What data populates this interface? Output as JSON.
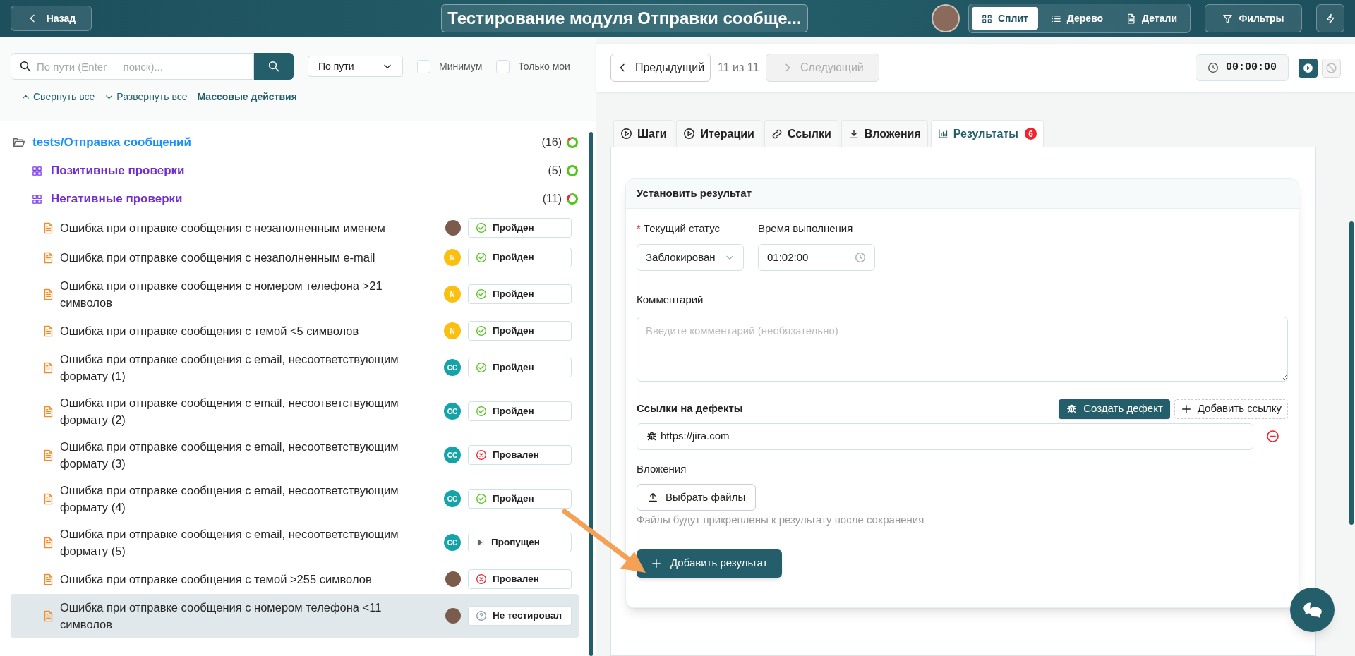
{
  "header": {
    "back": "Назад",
    "title": "Тестирование модуля Отправки сообще...",
    "views": [
      {
        "label": "Сплит",
        "kind": "split",
        "selected": true
      },
      {
        "label": "Дерево",
        "kind": "tree",
        "selected": false
      },
      {
        "label": "Детали",
        "kind": "details",
        "selected": false
      }
    ],
    "filters": "Фильтры"
  },
  "sidebar": {
    "search": {
      "placeholder": "По пути (Enter — поиск)..."
    },
    "sort": "По пути",
    "checkboxes": [
      {
        "label": "Минимум",
        "checked": false
      },
      {
        "label": "Только мои",
        "checked": false
      }
    ],
    "actions": [
      {
        "label": "Свернуть все",
        "kind": "collapse"
      },
      {
        "label": "Развернуть все",
        "kind": "expand"
      },
      {
        "label": "Массовые действия",
        "kind": "bulk"
      }
    ],
    "tree": [
      {
        "label": "tests/Отправка сообщений",
        "kind": "folder",
        "count": "(16)",
        "level": 0.8,
        "children": [
          {
            "label": "Позитивные проверки",
            "kind": "suite",
            "count": "(5)",
            "level": 1
          },
          {
            "label": "Негативные проверки",
            "kind": "suite",
            "count": "(11)",
            "level": 0.7,
            "children": [
              {
                "label": "Ошибка при отправке сообщения с незаполненным именем",
                "kind": "case",
                "selected": false,
                "assignee": {
                  "kind": "photo"
                },
                "status": {
                  "kind": "passed",
                  "label": "Пройден"
                }
              },
              {
                "label": "Ошибка при отправке сообщения с незаполненным e-mail",
                "kind": "case",
                "selected": false,
                "assignee": {
                  "kind": "initials",
                  "text": "N",
                  "color": "#fbbf0f"
                },
                "status": {
                  "kind": "passed",
                  "label": "Пройден"
                }
              },
              {
                "label": "Ошибка при отправке сообщения с номером телефона >21 символов",
                "kind": "case",
                "selected": false,
                "assignee": {
                  "kind": "initials",
                  "text": "N",
                  "color": "#fbbf0f"
                },
                "status": {
                  "kind": "passed",
                  "label": "Пройден"
                }
              },
              {
                "label": "Ошибка при отправке сообщения с темой <5 символов",
                "kind": "case",
                "selected": false,
                "assignee": {
                  "kind": "initials",
                  "text": "N",
                  "color": "#fbbf0f"
                },
                "status": {
                  "kind": "passed",
                  "label": "Пройден"
                }
              },
              {
                "label": "Ошибка при отправке сообщения с email, несоответствующим формату (1)",
                "kind": "case",
                "selected": false,
                "assignee": {
                  "kind": "initials",
                  "text": "CC",
                  "color": "#13a3a8"
                },
                "status": {
                  "kind": "passed",
                  "label": "Пройден"
                }
              },
              {
                "label": "Ошибка при отправке сообщения с email, несоответствующим формату (2)",
                "kind": "case",
                "selected": false,
                "assignee": {
                  "kind": "initials",
                  "text": "CC",
                  "color": "#13a3a8"
                },
                "status": {
                  "kind": "passed",
                  "label": "Пройден"
                }
              },
              {
                "label": "Ошибка при отправке сообщения с email, несоответствующим формату (3)",
                "kind": "case",
                "selected": false,
                "assignee": {
                  "kind": "initials",
                  "text": "CC",
                  "color": "#13a3a8"
                },
                "status": {
                  "kind": "failed",
                  "label": "Провален"
                }
              },
              {
                "label": "Ошибка при отправке сообщения с email, несоответствующим формату (4)",
                "kind": "case",
                "selected": false,
                "assignee": {
                  "kind": "initials",
                  "text": "CC",
                  "color": "#13a3a8"
                },
                "status": {
                  "kind": "passed",
                  "label": "Пройден"
                }
              },
              {
                "label": "Ошибка при отправке сообщения с email, несоответствующим формату (5)",
                "kind": "case",
                "selected": false,
                "assignee": {
                  "kind": "initials",
                  "text": "CC",
                  "color": "#13a3a8"
                },
                "status": {
                  "kind": "skipped",
                  "label": "Пропущен"
                }
              },
              {
                "label": "Ошибка при отправке сообщения с темой >255 символов",
                "kind": "case",
                "selected": false,
                "assignee": {
                  "kind": "photo"
                },
                "status": {
                  "kind": "failed",
                  "label": "Провален"
                }
              },
              {
                "label": "Ошибка при отправке сообщения с номером телефона <11 символов",
                "kind": "case",
                "selected": true,
                "assignee": {
                  "kind": "photo"
                },
                "status": {
                  "kind": "untested",
                  "label": "Не тестировал"
                }
              }
            ]
          }
        ]
      }
    ]
  },
  "navigator": {
    "prev": "Предыдущий",
    "position": "11 из 11",
    "next": {
      "label": "Следующий",
      "disabled": true
    },
    "timer": "00:00:00",
    "play": {
      "disabled": false
    },
    "stop": {
      "disabled": true
    }
  },
  "tabs": [
    {
      "label": "Шаги",
      "kind": "steps",
      "selected": false
    },
    {
      "label": "Итерации",
      "kind": "iterations",
      "selected": false
    },
    {
      "label": "Ссылки",
      "kind": "links",
      "selected": false
    },
    {
      "label": "Вложения",
      "kind": "attachments",
      "selected": false
    },
    {
      "label": "Результаты",
      "kind": "results",
      "selected": true,
      "badge": "6"
    }
  ],
  "result_form": {
    "title": "Установить результат",
    "status_field": {
      "label": "Текущий статус",
      "marker": "*",
      "value": "Заблокирован"
    },
    "time_field": {
      "label": "Время выполнения",
      "value": "01:02:00"
    },
    "comment": {
      "label": "Комментарий",
      "placeholder": "Введите комментарий (необязательно)"
    },
    "defects": {
      "title": "Ссылки на дефекты",
      "create_button": "Создать дефект",
      "add_button": "Добавить ссылку",
      "links": [
        {
          "url": "https://jira.com"
        }
      ]
    },
    "attachments": {
      "label": "Вложения",
      "button": "Выбрать файлы",
      "hint": "Файлы будут прикреплены к результату после сохранения"
    },
    "submit": "Добавить результат"
  }
}
